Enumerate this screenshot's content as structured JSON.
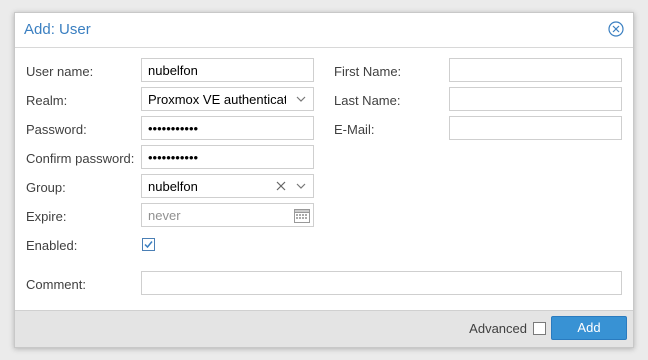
{
  "dialog": {
    "title": "Add: User"
  },
  "form": {
    "username": {
      "label": "User name:",
      "value": "nubelfon"
    },
    "realm": {
      "label": "Realm:",
      "value": "Proxmox VE authenticat"
    },
    "password": {
      "label": "Password:",
      "value": "•••••••••••"
    },
    "confirm_password": {
      "label": "Confirm password:",
      "value": "•••••••••••"
    },
    "group": {
      "label": "Group:",
      "value": "nubelfon"
    },
    "expire": {
      "label": "Expire:",
      "placeholder": "never"
    },
    "enabled": {
      "label": "Enabled:",
      "checked": true
    },
    "comment": {
      "label": "Comment:",
      "value": ""
    },
    "first_name": {
      "label": "First Name:",
      "value": ""
    },
    "last_name": {
      "label": "Last Name:",
      "value": ""
    },
    "email": {
      "label": "E-Mail:",
      "value": ""
    }
  },
  "footer": {
    "advanced_label": "Advanced",
    "advanced_checked": false,
    "add_label": "Add"
  },
  "colors": {
    "title": "#3a7fc1",
    "accent_button": "#3892d4",
    "checkbox": "#4a7fb5"
  },
  "icons": {
    "close": "close-circle-icon",
    "dropdown": "chevron-down-icon",
    "clear": "clear-x-icon",
    "calendar": "calendar-icon",
    "check": "checkmark-icon"
  }
}
